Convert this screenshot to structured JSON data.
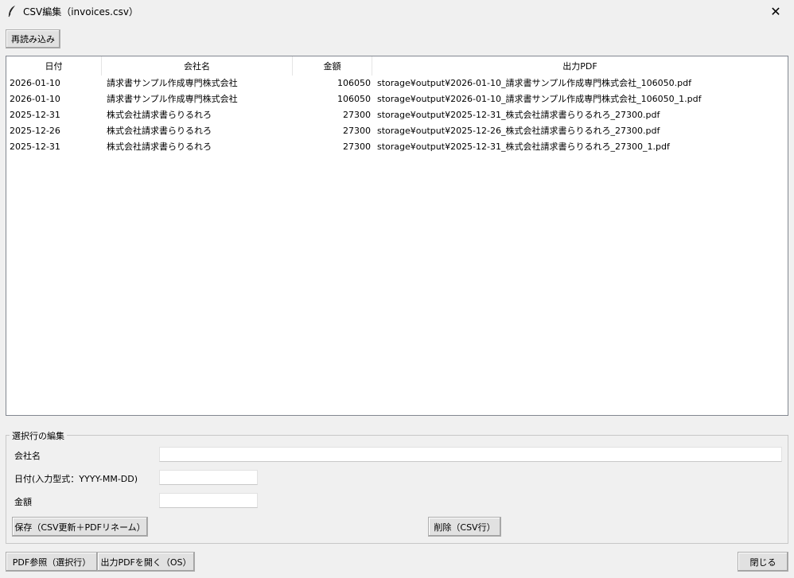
{
  "window": {
    "title": "CSV編集（invoices.csv）",
    "close_glyph": "✕"
  },
  "toolbar": {
    "reload_label": "再読み込み"
  },
  "table": {
    "columns": [
      "日付",
      "会社名",
      "金額",
      "出力PDF"
    ],
    "rows": [
      {
        "date": "2026-01-10",
        "company": "請求書サンプル作成専門株式会社",
        "amount": "106050",
        "pdf": "storage¥output¥2026-01-10_請求書サンプル作成専門株式会社_106050.pdf"
      },
      {
        "date": "2026-01-10",
        "company": "請求書サンプル作成専門株式会社",
        "amount": "106050",
        "pdf": "storage¥output¥2026-01-10_請求書サンプル作成専門株式会社_106050_1.pdf"
      },
      {
        "date": "2025-12-31",
        "company": "株式会社請求書らりるれろ",
        "amount": "27300",
        "pdf": "storage¥output¥2025-12-31_株式会社請求書らりるれろ_27300.pdf"
      },
      {
        "date": "2025-12-26",
        "company": "株式会社請求書らりるれろ",
        "amount": "27300",
        "pdf": "storage¥output¥2025-12-26_株式会社請求書らりるれろ_27300.pdf"
      },
      {
        "date": "2025-12-31",
        "company": "株式会社請求書らりるれろ",
        "amount": "27300",
        "pdf": "storage¥output¥2025-12-31_株式会社請求書らりるれろ_27300_1.pdf"
      }
    ]
  },
  "edit": {
    "legend": "選択行の編集",
    "company_label": "会社名",
    "company_value": "",
    "date_label": "日付(入力型式：YYYY-MM-DD)",
    "date_value": "",
    "amount_label": "金額",
    "amount_value": "",
    "save_label": "保存（CSV更新＋PDFリネーム）",
    "delete_label": "削除（CSV行）"
  },
  "footer": {
    "pdf_ref_label": "PDF参照（選択行）",
    "open_pdf_label": "出力PDFを開く（OS）",
    "close_label": "閉じる"
  }
}
